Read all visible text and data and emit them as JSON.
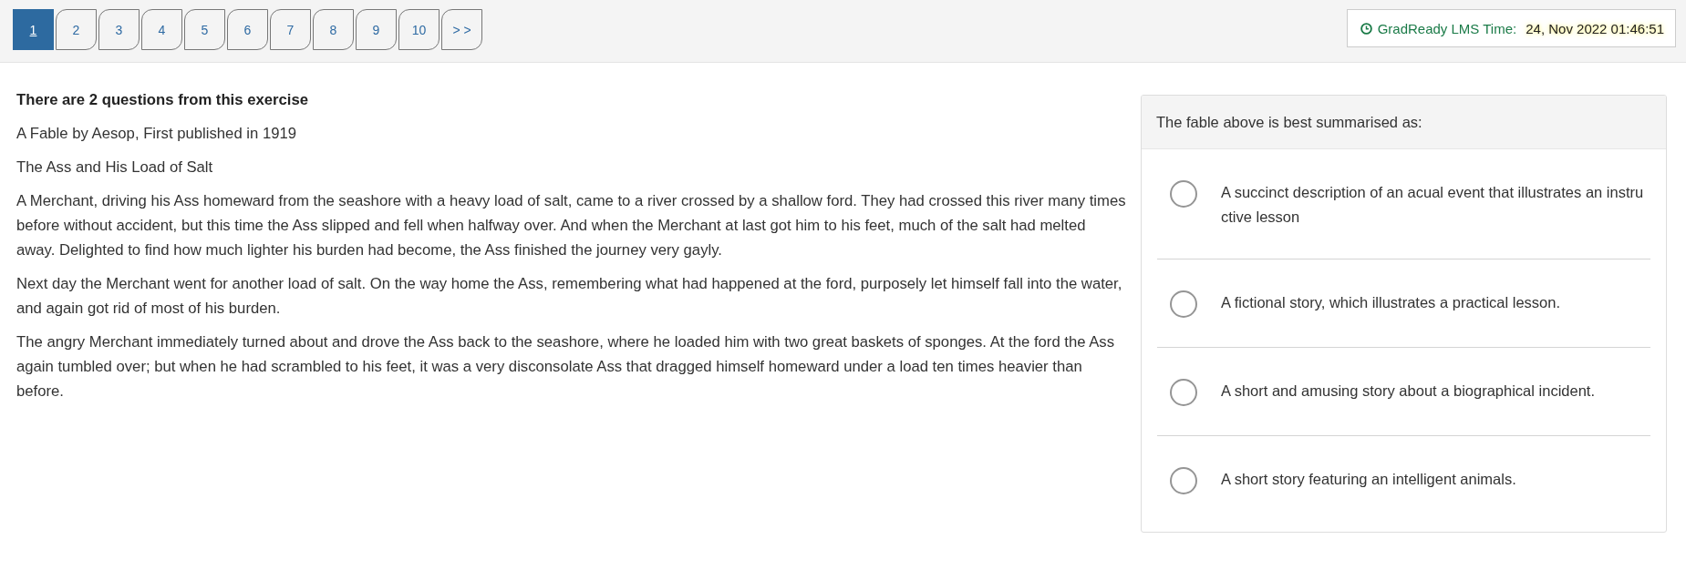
{
  "pagination": {
    "pages": [
      {
        "label": "1",
        "selected": true
      },
      {
        "label": "2",
        "selected": false
      },
      {
        "label": "3",
        "selected": false
      },
      {
        "label": "4",
        "selected": false
      },
      {
        "label": "5",
        "selected": false
      },
      {
        "label": "6",
        "selected": false
      },
      {
        "label": "7",
        "selected": false
      },
      {
        "label": "8",
        "selected": false
      },
      {
        "label": "9",
        "selected": false
      },
      {
        "label": "10",
        "selected": false
      }
    ],
    "next": "> >"
  },
  "clock": {
    "label": "GradReady LMS Time:",
    "value": "24, Nov 2022 01:46:51"
  },
  "exercise": {
    "heading": "There are 2 questions from this exercise",
    "source": "A Fable by Aesop, First published in 1919",
    "title": "The Ass and His Load of Salt",
    "paragraphs": [
      "A Merchant, driving his Ass homeward from the seashore with a heavy load of salt, came to a river crossed by a shallow ford. They had crossed this river many times before without accident, but this time the Ass slipped and fell when halfway over. And when the Merchant at last got him to his feet, much of the salt had melted away. Delighted to find how much lighter his burden had become, the Ass finished the journey very gayly.",
      "Next day the Merchant went for another load of salt. On the way home the Ass, remembering what had happened at the ford, purposely let himself fall into the water, and again got rid of most of his burden.",
      "The angry Merchant immediately turned about and drove the Ass back to the seashore, where he loaded him with two great baskets of sponges. At the ford the Ass again tumbled over; but when he had scrambled to his feet, it was a very disconsolate Ass that dragged himself homeward under a load ten times heavier than before."
    ]
  },
  "question": {
    "prompt": "The fable above is best summarised as:",
    "options": [
      {
        "text": "A succinct description of an acual event that illustrates an instructive lesson",
        "selected": false
      },
      {
        "text": "A fictional story, which illustrates a practical lesson.",
        "selected": false
      },
      {
        "text": "A short and amusing story about a biographical incident.",
        "selected": false
      },
      {
        "text": "A short story featuring an intelligent animals.",
        "selected": false
      }
    ]
  }
}
